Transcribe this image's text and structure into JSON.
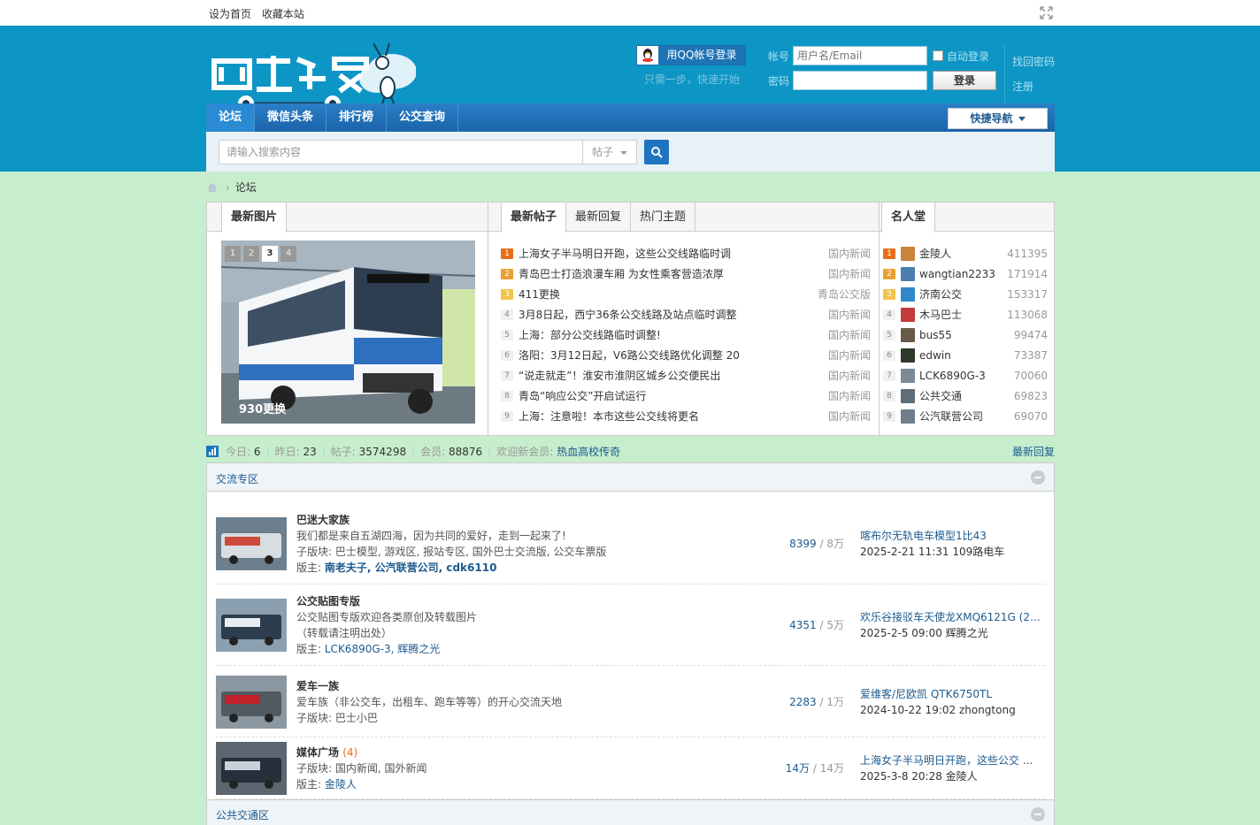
{
  "topbar": {
    "set_home": "设为首页",
    "bookmark": "收藏本站"
  },
  "header": {
    "qq_login": "用QQ帐号登录",
    "qq_hint": "只需一步，快速开始",
    "account_label": "帐号",
    "account_placeholder": "用户名/Email",
    "password_label": "密码",
    "auto_login": "自动登录",
    "login_button": "登录",
    "find_password": "找回密码",
    "register": "注册"
  },
  "nav": {
    "items": [
      "论坛",
      "微信头条",
      "排行榜",
      "公交查询"
    ],
    "quick_nav": "快捷导航"
  },
  "search": {
    "placeholder": "请输入搜索内容",
    "type": "帖子"
  },
  "breadcrumb": {
    "current": "论坛"
  },
  "portal": {
    "pics_tab": "最新图片",
    "slide_pages": [
      "1",
      "2",
      "3",
      "4"
    ],
    "slide_caption": "930更换",
    "thread_tabs": [
      "最新帖子",
      "最新回复",
      "热门主题"
    ],
    "threads": [
      {
        "n": "1",
        "title": "上海女子半马明日开跑，这些公交线路临时调",
        "forum": "国内新闻"
      },
      {
        "n": "2",
        "title": "青岛巴士打造浪漫车厢 为女性乘客营造浓厚",
        "forum": "国内新闻"
      },
      {
        "n": "3",
        "title": "411更换",
        "forum": "青岛公交版"
      },
      {
        "n": "4",
        "title": "3月8日起，西宁36条公交线路及站点临时调整",
        "forum": "国内新闻"
      },
      {
        "n": "5",
        "title": "上海：部分公交线路临时调整!",
        "forum": "国内新闻"
      },
      {
        "n": "6",
        "title": "洛阳：3月12日起，V6路公交线路优化调整 20",
        "forum": "国内新闻"
      },
      {
        "n": "7",
        "title": "“说走就走”！淮安市淮阴区城乡公交便民出",
        "forum": "国内新闻"
      },
      {
        "n": "8",
        "title": "青岛“响应公交”开启试运行",
        "forum": "国内新闻"
      },
      {
        "n": "9",
        "title": "上海：注意啦！本市这些公交线将更名",
        "forum": "国内新闻"
      }
    ],
    "rank_tab": "名人堂",
    "ranks": [
      {
        "n": "1",
        "name": "金陵人",
        "score": "411395",
        "color": "#c8843a"
      },
      {
        "n": "2",
        "name": "wangtian2233",
        "score": "171914",
        "color": "#4a7fb0"
      },
      {
        "n": "3",
        "name": "济南公交",
        "score": "153317",
        "color": "#2f87c9"
      },
      {
        "n": "4",
        "name": "木马巴士",
        "score": "113068",
        "color": "#c23b3b"
      },
      {
        "n": "5",
        "name": "bus55",
        "score": "99474",
        "color": "#6a5a4a"
      },
      {
        "n": "6",
        "name": "edwin",
        "score": "73387",
        "color": "#2d3a2a"
      },
      {
        "n": "7",
        "name": "LCK6890G-3",
        "score": "70060",
        "color": "#7a8a99"
      },
      {
        "n": "8",
        "name": "公共交通",
        "score": "69823",
        "color": "#5d6d7a"
      },
      {
        "n": "9",
        "name": "公汽联营公司",
        "score": "69070",
        "color": "#6e7e8c"
      }
    ]
  },
  "stats": {
    "today_label": "今日:",
    "today": "6",
    "yesterday_label": "昨日:",
    "yesterday": "23",
    "posts_label": "帖子:",
    "posts": "3574298",
    "members_label": "会员:",
    "members": "88876",
    "welcome_label": "欢迎新会员:",
    "newest_member": "热血高校传奇",
    "latest_reply": "最新回复"
  },
  "forum": {
    "section1": "交流专区",
    "section2": "公共交通区",
    "rows": [
      {
        "name": "巴迷大家族",
        "cnt": "",
        "desc": "我们都是来自五湖四海，因为共同的爱好，走到一起来了!",
        "subs_label": "子版块:",
        "subs": "巴士模型, 游戏区, 报站专区, 国外巴士交流版, 公交车票版",
        "mods_label": "版主:",
        "mods": "南老夫子, 公汽联营公司, cdk6110",
        "threads": "8399",
        "total": "8万",
        "last_title": "喀布尔无轨电车模型1比43",
        "last_meta": "2025-2-21 11:31 109路电车"
      },
      {
        "name": "公交贴图专版",
        "cnt": "",
        "desc": "公交贴图专版欢迎各类原创及转载图片",
        "desc2": "（转载请注明出处）",
        "subs_label": "",
        "subs": "",
        "mods_label": "版主:",
        "mods": "LCK6890G-3, 辉腾之光",
        "threads": "4351",
        "total": "5万",
        "last_title": "欢乐谷接驳车天使龙XMQ6121G (20 ...",
        "last_meta": "2025-2-5 09:00 辉腾之光"
      },
      {
        "name": "爱车一族",
        "cnt": "",
        "desc": "爱车族（非公交车，出租车、跑车等等）的开心交流天地",
        "subs_label": "子版块:",
        "subs": "巴士小巴",
        "mods_label": "",
        "mods": "",
        "threads": "2283",
        "total": "1万",
        "last_title": "爱维客/尼欧凯 QTK6750TL",
        "last_meta": "2024-10-22 19:02 zhongtong"
      },
      {
        "name": "媒体广场",
        "cnt": "(4)",
        "desc": "",
        "subs_label": "子版块:",
        "subs": "国内新闻, 国外新闻",
        "mods_label": "版主:",
        "mods": "金陵人",
        "threads": "14万",
        "total": "14万",
        "last_title": "上海女子半马明日开跑，这些公交 ...",
        "last_meta": "2025-3-8 20:28 金陵人"
      }
    ]
  }
}
